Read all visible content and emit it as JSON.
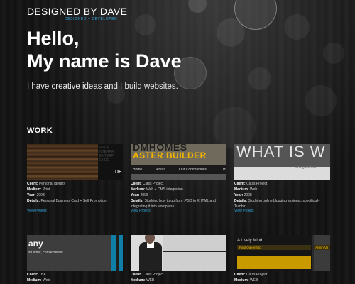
{
  "logo": {
    "title": "DESIGNED BY DAVE",
    "subtitle": "DESIGNED + DEVELOPED"
  },
  "hero": {
    "line1": "Hello,",
    "line2": "My name is Dave",
    "tagline": "I have creative ideas and I build websites."
  },
  "work_heading": "WORK",
  "labels": {
    "client": "Client:",
    "medium": "Medium:",
    "year": "Year:",
    "details": "Details:"
  },
  "projects": [
    {
      "client": "Personal Identity",
      "medium": "Print",
      "year": "2008",
      "details": "Personal Business Card + Self Promotion.",
      "view": "View Project",
      "thumb_text": "DE"
    },
    {
      "client": "Class Project",
      "medium": "Web + CMS integration",
      "year": "2008",
      "details": "Studying how to go from .PSD to XHTML and integrating it into wordpress",
      "view": "View Project",
      "thumb_title": "DMHOMES",
      "thumb_sub": "ASTER BUILDER",
      "thumb_nav": [
        "Home",
        "About",
        "Our Communities",
        "H"
      ]
    },
    {
      "client": "Class Project",
      "medium": "Web",
      "year": "2008",
      "details": "Studying online blogging systems, specifically Tumblr.",
      "view": "View Project",
      "thumb_title": "WHAT IS W",
      "thumb_sub": "a blog with alo"
    },
    {
      "client": "TBA",
      "medium": "Web",
      "thumb_title": "any",
      "thumb_sub": "sit amet, consectetuer."
    },
    {
      "client": "Class Project",
      "medium": "WEB"
    },
    {
      "client": "Class Project",
      "medium": "WEB",
      "thumb_title": "A Lively Mind",
      "thumb_sub": "Paul Oakenfold",
      "thumb_side": "Armin Va"
    }
  ],
  "colors": {
    "accent": "#34a7e0",
    "background": "#0c0c0c"
  }
}
